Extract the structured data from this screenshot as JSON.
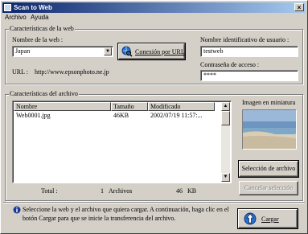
{
  "window": {
    "title": "Scan to Web",
    "close_glyph": "×"
  },
  "menu": {
    "items": [
      "Archivo",
      "Ayuda"
    ]
  },
  "web_group": {
    "title": "Características de la web",
    "name_label": "Nombre de la web :",
    "name_value": "Japan",
    "connect_button": "Conexión por URL",
    "url_label": "URL :",
    "url_value": "http://www.epsonphoto.ne.jp",
    "user_label": "Nombre identificativo de usuario :",
    "user_value": "testweb",
    "password_label": "Contraseña de acceso :",
    "password_value": "****"
  },
  "file_group": {
    "title": "Características del archivo",
    "columns": [
      "Nombre",
      "Tamaño",
      "Modificado"
    ],
    "rows": [
      {
        "name": "Web0001.jpg",
        "size": "46KB",
        "modified": "2002/07/19 11:57:..."
      }
    ],
    "total_label": "Total :",
    "total_count": "1",
    "total_unit": "Archivos",
    "total_size": "46",
    "total_size_unit": "KB"
  },
  "thumbnail": {
    "label": "Imagen en miniatura"
  },
  "buttons": {
    "select_file": "Selección de archivo",
    "cancel_selection": "Cancelar selección",
    "upload": "Cargar"
  },
  "info": {
    "line1": "Seleccione la web y el archivo que quiera cargar. A continuación, haga clic en el",
    "line2": "botón Cargar para que se inicie la transferencia del archivo."
  },
  "icons": {
    "connect": "globe-magnifier-icon",
    "info": "info-icon",
    "upload": "upload-icon",
    "dropdown": "chevron-down-icon"
  },
  "colors": {
    "title_start": "#0a246a",
    "title_end": "#a6caf0",
    "face": "#d4d0c8"
  }
}
